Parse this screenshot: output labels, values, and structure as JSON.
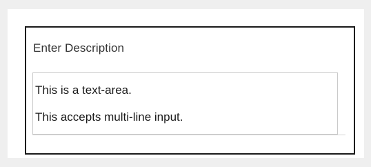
{
  "form": {
    "label": "Enter Description",
    "textarea": {
      "lines": [
        "This is a text-area.",
        "This accepts multi-line input."
      ]
    }
  },
  "colors": {
    "page_background": "#efefef",
    "card_background": "#ffffff",
    "border": "#1a1a1a",
    "textarea_border": "#c9c9c9",
    "text": "#1a1a1a",
    "label_text": "#333333"
  }
}
